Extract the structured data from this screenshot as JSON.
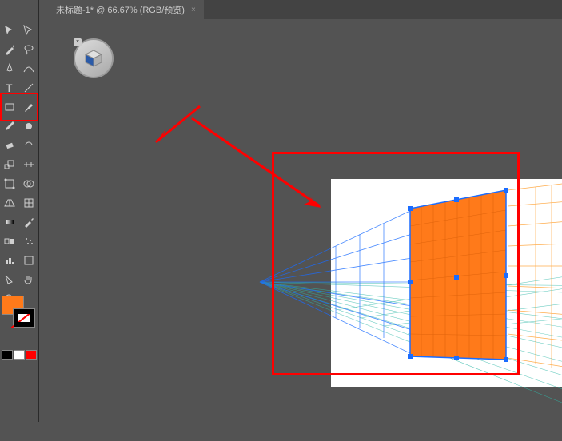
{
  "tab": {
    "title": "未标题-1* @ 66.67% (RGB/预览)",
    "close": "×"
  },
  "colors": {
    "fill": "#ff7a1a",
    "stroke": "#000000",
    "accent_red": "#ff0000",
    "grid_blue": "#1a6cff",
    "grid_orange": "#ff8a00",
    "grid_green": "#2ab85a",
    "grid_teal": "#2fb8a8"
  },
  "tools": [
    "selection-tool",
    "direct-selection-tool",
    "magic-wand-tool",
    "lasso-tool",
    "pen-tool",
    "curvature-tool",
    "type-tool",
    "line-segment-tool",
    "rectangle-tool",
    "paintbrush-tool",
    "pencil-tool",
    "blob-brush-tool",
    "eraser-tool",
    "rotate-tool",
    "scale-tool",
    "width-tool",
    "free-transform-tool",
    "shape-builder-tool",
    "perspective-grid-tool",
    "mesh-tool",
    "gradient-tool",
    "eyedropper-tool",
    "blend-tool",
    "symbol-sprayer-tool",
    "column-graph-tool",
    "artboard-tool",
    "slice-tool",
    "hand-tool",
    "zoom-tool",
    "fill-toggle"
  ],
  "mini_swatches": [
    "#000000",
    "#ffffff",
    "#ff0000"
  ],
  "zoom": "66.67%",
  "color_mode": "RGB/预览",
  "filename": "未标题-1"
}
